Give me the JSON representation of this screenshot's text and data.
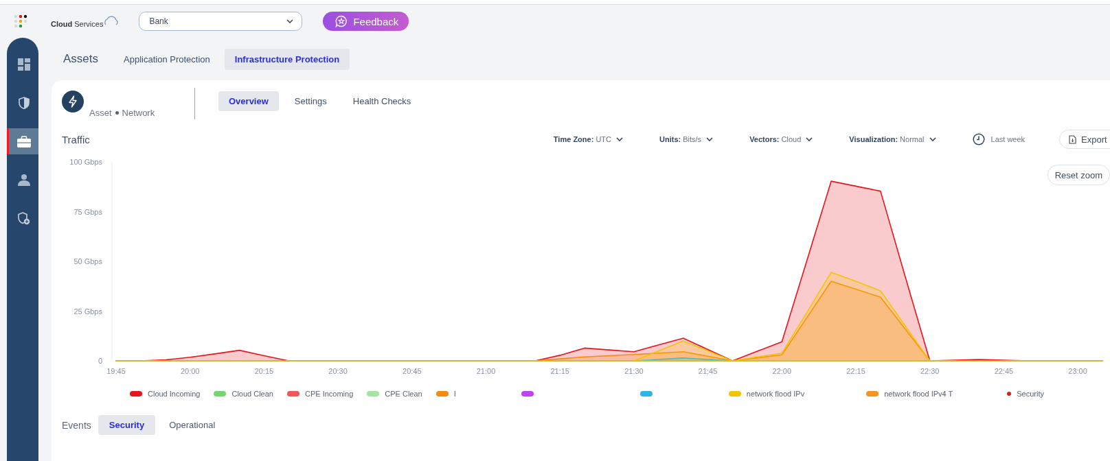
{
  "header": {
    "logo_text": "**Cloud** Services",
    "account_select": {
      "value": "Bank"
    },
    "feedback_button": "Feedback"
  },
  "sidebar": {
    "items": [
      {
        "kind": "dashboard",
        "selected": false
      },
      {
        "kind": "shield",
        "selected": false
      },
      {
        "kind": "briefcase",
        "selected": true
      },
      {
        "kind": "user",
        "selected": false
      },
      {
        "kind": "shield-plus",
        "selected": false
      }
    ]
  },
  "section_tabs": {
    "title": "Assets",
    "tabs": [
      {
        "label": "Application Protection",
        "selected": false
      },
      {
        "label": "Infrastructure Protection",
        "selected": true
      }
    ]
  },
  "asset": {
    "type": "Asset",
    "category": "Network",
    "tabs": [
      {
        "label": "Overview",
        "selected": true
      },
      {
        "label": "Settings",
        "selected": false
      },
      {
        "label": "Health Checks",
        "selected": false
      }
    ]
  },
  "traffic": {
    "title": "Traffic",
    "filters": [
      {
        "label": "Time Zone:",
        "value": "UTC"
      },
      {
        "label": "Units:",
        "value": "Bits/s"
      },
      {
        "label": "Vectors:",
        "value": "Cloud"
      },
      {
        "label": "Visualization:",
        "value": "Normal"
      }
    ],
    "time_range": "Last week",
    "export_button": "Export",
    "reset_zoom_button": "Reset zoom",
    "chart_data": {
      "type": "area",
      "stacked": false,
      "categories": [
        "19:45",
        null,
        null,
        "20:00",
        null,
        null,
        "20:15",
        null,
        null,
        "20:30",
        null,
        null,
        "20:45",
        null,
        null,
        "21:00",
        null,
        null,
        "21:15",
        null,
        null,
        "21:30",
        null,
        null,
        "21:45",
        null,
        null,
        "22:00",
        null,
        null,
        "22:15",
        null,
        null,
        "22:30",
        null,
        null,
        "22:45",
        null,
        null,
        "23:00",
        null
      ],
      "ylim": [
        0,
        100
      ],
      "yticks": [
        {
          "value": 0,
          "label": "0"
        },
        {
          "value": 25,
          "label": "25 Gbps"
        },
        {
          "value": 50,
          "label": "50 Gbps"
        },
        {
          "value": 75,
          "label": "75 Gbps"
        },
        {
          "value": 100,
          "label": "100 Gbps"
        }
      ],
      "series": [
        {
          "name": "Cloud Incoming",
          "color": "#e8141b",
          "values": [
            0,
            0,
            0.5,
            1.8,
            3.5,
            5.3,
            2.6,
            0,
            0,
            0,
            0,
            0,
            0,
            0,
            0,
            0,
            0,
            0,
            2.8,
            6.4,
            5.5,
            4.6,
            8,
            11.4,
            5.7,
            0,
            4.8,
            9.6,
            49.8,
            90.3,
            87.8,
            85.3,
            42.4,
            0,
            0.3,
            0.7,
            0.3,
            0,
            0,
            0,
            0
          ]
        },
        {
          "name": "Cloud Clean",
          "color": "#72d86e",
          "values": [
            null,
            null,
            null,
            null,
            null,
            null,
            null,
            null,
            null,
            null,
            null,
            null,
            null,
            null,
            null,
            null,
            null,
            null,
            null,
            null,
            null,
            null,
            null,
            null,
            null,
            null,
            null,
            null,
            null,
            null,
            null,
            null,
            null,
            null,
            null,
            null,
            null,
            null,
            null,
            null,
            null
          ]
        },
        {
          "name": "CPE Incoming",
          "color": "#f25656",
          "values": [
            null,
            null,
            null,
            null,
            null,
            null,
            null,
            null,
            null,
            null,
            null,
            null,
            null,
            null,
            null,
            null,
            null,
            null,
            null,
            null,
            null,
            null,
            null,
            null,
            null,
            null,
            null,
            null,
            null,
            null,
            null,
            null,
            null,
            null,
            null,
            null,
            null,
            null,
            null,
            null,
            null
          ]
        },
        {
          "name": "CPE Clean",
          "color": "#a3e6a0",
          "values": [
            null,
            null,
            null,
            null,
            null,
            null,
            null,
            null,
            null,
            null,
            null,
            null,
            null,
            null,
            null,
            null,
            null,
            null,
            null,
            null,
            null,
            null,
            null,
            null,
            null,
            null,
            null,
            null,
            null,
            null,
            null,
            null,
            null,
            null,
            null,
            null,
            null,
            null,
            null,
            null,
            null
          ]
        },
        {
          "name": "I",
          "color": "#f58a0c",
          "values": [
            0,
            0,
            0,
            0,
            0,
            0,
            0,
            0,
            0,
            0,
            0,
            0,
            0,
            0,
            0,
            0,
            0,
            0,
            1,
            2,
            2.6,
            3.2,
            3.9,
            4.6,
            2.3,
            0,
            1.5,
            3,
            21.5,
            40,
            36,
            32,
            16,
            0,
            0,
            0,
            0,
            0,
            0,
            0,
            0
          ]
        },
        {
          "color": "#c241f0",
          "values": [
            null,
            null,
            null,
            null,
            null,
            null,
            null,
            null,
            null,
            null,
            null,
            null,
            null,
            null,
            null,
            null,
            null,
            null,
            null,
            null,
            null,
            null,
            null,
            null,
            null,
            null,
            null,
            null,
            null,
            null,
            null,
            null,
            null,
            null,
            null,
            null,
            null,
            null,
            null,
            null,
            null
          ]
        },
        {
          "color": "#2bb5e6",
          "values": [
            0,
            0,
            0,
            0,
            0,
            0,
            0,
            0,
            0,
            0,
            0,
            0,
            0,
            0,
            0,
            0,
            0,
            0,
            0,
            0,
            0,
            0,
            0.7,
            1.4,
            0.7,
            0,
            0,
            0,
            0,
            0,
            0,
            0,
            0,
            0,
            0,
            0,
            0,
            0,
            0,
            0,
            0
          ]
        },
        {
          "name": "network flood IPv",
          "color": "#f5c400",
          "values": [
            0,
            0,
            0,
            0,
            0,
            0,
            0,
            0,
            0,
            0,
            0,
            0,
            0,
            0,
            0,
            0,
            0,
            0,
            0,
            0,
            0,
            0,
            5,
            10,
            5,
            0,
            2,
            3.9,
            24,
            44.5,
            40,
            35.2,
            17.6,
            0,
            0,
            0,
            0,
            0,
            0,
            0,
            0
          ]
        },
        {
          "name": "network flood IPv4 T",
          "color": "#f7941d",
          "values": [
            null,
            null,
            null,
            null,
            null,
            null,
            null,
            null,
            null,
            null,
            null,
            null,
            null,
            null,
            null,
            null,
            null,
            null,
            null,
            null,
            null,
            null,
            null,
            null,
            null,
            null,
            null,
            null,
            null,
            null,
            null,
            null,
            null,
            null,
            null,
            null,
            null,
            null,
            null,
            null,
            null
          ]
        }
      ]
    },
    "event_legend": {
      "label": "Security",
      "color": "#d91c1c"
    }
  },
  "events": {
    "title": "Events",
    "tabs": [
      {
        "label": "Security",
        "selected": true
      },
      {
        "label": "Operational",
        "selected": false
      }
    ]
  }
}
